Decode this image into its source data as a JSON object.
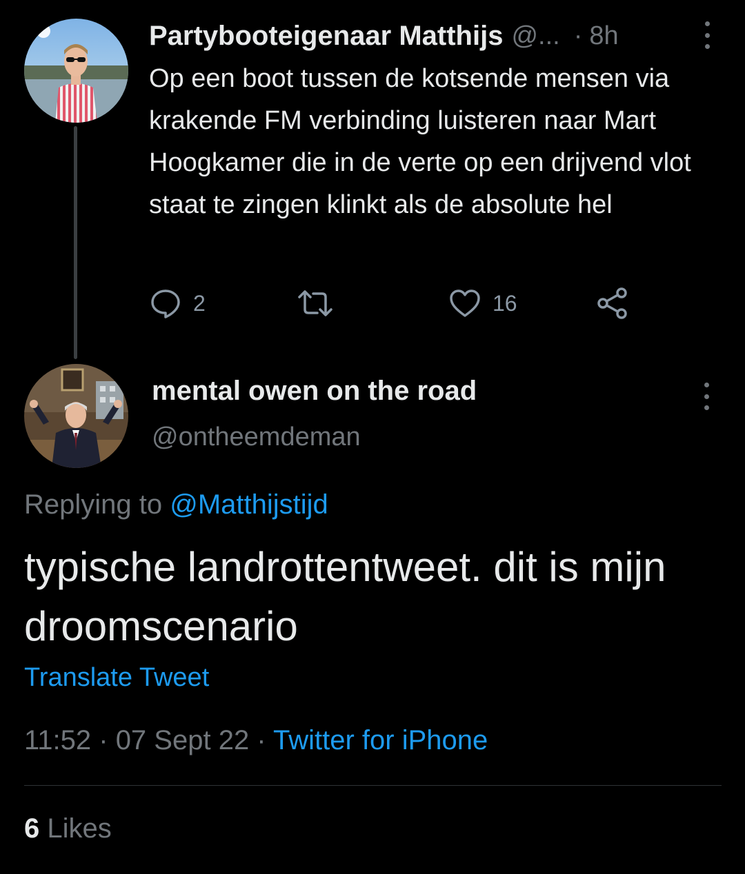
{
  "parent_tweet": {
    "author_name": "Partybooteigenaar Matthijs",
    "author_handle": "@...",
    "separator": "·",
    "time": "8h",
    "text": "Op een boot tussen de kotsende mensen via krakende FM verbinding luisteren naar Mart Hoogkamer die in de verte op een drijvend vlot staat te zingen klinkt als de absolute hel",
    "actions": {
      "reply_count": "2",
      "retweet_count": "",
      "like_count": "16"
    }
  },
  "reply_tweet": {
    "author_name": "mental owen on the road",
    "author_handle": "@ontheemdeman",
    "replying_prefix": "Replying to ",
    "replying_mention": "@Matthijstijd",
    "text": "typische landrottentweet. dit is mijn droomscenario",
    "translate_label": "Translate Tweet",
    "time": "11:52",
    "separator": " · ",
    "date": "07 Sept 22",
    "source": "Twitter for iPhone",
    "likes_count": "6",
    "likes_label": " Likes"
  },
  "colors": {
    "background": "#000000",
    "text_primary": "#e7e9ea",
    "text_secondary": "#71767b",
    "accent": "#1d9bf0"
  },
  "icons": {
    "reply": "speech-bubble-icon",
    "retweet": "retweet-arrows-icon",
    "like": "heart-icon",
    "share": "share-nodes-icon",
    "more": "more-vertical-icon"
  }
}
